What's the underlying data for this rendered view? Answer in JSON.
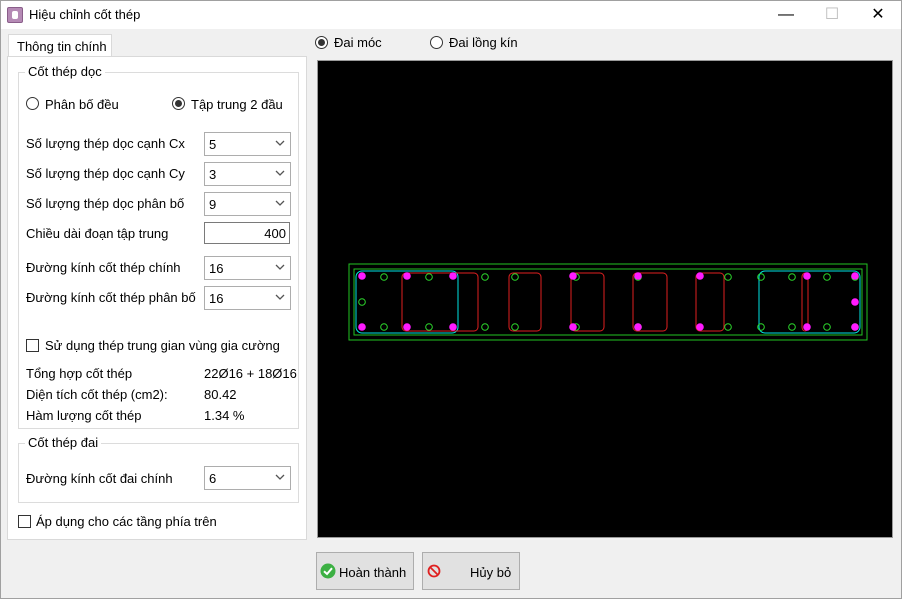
{
  "window": {
    "title": "Hiệu chỉnh cốt thép",
    "minimize": "—",
    "maximize": "☐",
    "close": "✕"
  },
  "tab": {
    "label": "Thông tin chính"
  },
  "top_radios": {
    "dai_moc": {
      "label": "Đai móc",
      "checked": true
    },
    "dai_long_kin": {
      "label": "Đai lồng kín",
      "checked": false
    }
  },
  "cot_thep_doc": {
    "group_label": "Cốt thép dọc",
    "radio_phan_bo_deu": {
      "label": "Phân bố đều",
      "checked": false
    },
    "radio_tap_trung": {
      "label": "Tập trung 2 đầu",
      "checked": true
    },
    "fields": {
      "so_luong_cx": {
        "label": "Số lượng thép dọc cạnh Cx",
        "value": "5"
      },
      "so_luong_cy": {
        "label": "Số lượng thép dọc cạnh Cy",
        "value": "3"
      },
      "so_luong_phan_bo": {
        "label": "Số lượng thép dọc phân bố",
        "value": "9"
      },
      "chieu_dai": {
        "label": "Chiều dài đoạn tập trung",
        "value": "400"
      },
      "duong_kinh_chinh": {
        "label": "Đường kính cốt thép chính",
        "value": "16"
      },
      "duong_kinh_phan_bo": {
        "label": "Đường kính cốt thép phân bố",
        "value": "16"
      }
    },
    "checkbox_trung_gian": {
      "label": "Sử dụng thép trung gian vùng gia cường",
      "checked": false
    },
    "summary": {
      "tong_hop": {
        "label": "Tổng hợp cốt thép",
        "value": "22Ø16 + 18Ø16"
      },
      "dien_tich": {
        "label": "Diện tích cốt thép (cm2):",
        "value": "80.42"
      },
      "ham_luong": {
        "label": "Hàm lượng cốt thép",
        "value": "1.34 %"
      }
    }
  },
  "cot_thep_dai": {
    "group_label": "Cốt thép đai",
    "duong_kinh_dai": {
      "label": "Đường kính cốt đai chính",
      "value": "6"
    }
  },
  "checkbox_ap_dung": {
    "label": "Áp dụng cho các tầng phía trên",
    "checked": false
  },
  "buttons": {
    "hoan_thanh": {
      "label": "Hoàn thành",
      "icon": "check-icon"
    },
    "huy_bo": {
      "label": "Hủy bỏ",
      "icon": "cancel-icon"
    }
  },
  "colors": {
    "canvas_bg": "#000000",
    "outline": "#22c322",
    "stirrup_end": "#00e5e5",
    "stirrup_mid": "#e02020",
    "main_bar": "#ff1aff",
    "dist_bar": "#2cd82c"
  }
}
